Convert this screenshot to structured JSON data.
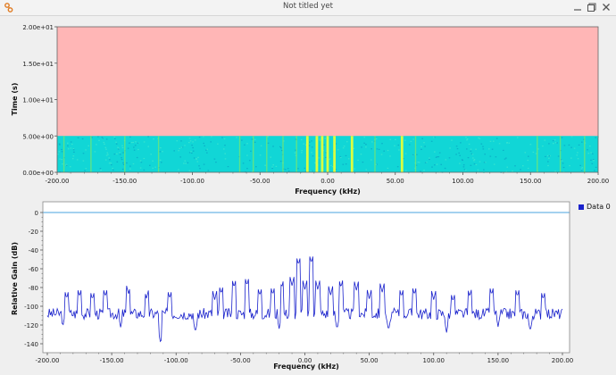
{
  "window": {
    "title": "Not titled yet"
  },
  "colors": {
    "waterfall_background": "#ffb6b6",
    "waterfall_fill": "#11d6d6",
    "waterfall_strong": "#e4ff3a",
    "spectrum_trace": "#1a22cc",
    "reference_line": "#4aa3df"
  },
  "icons": {
    "app": "gnuradio-icon",
    "minimize": "minimize-icon",
    "maximize": "maximize-icon",
    "close": "close-icon"
  },
  "waterfall": {
    "ylabel": "Time (s)",
    "xlabel": "Frequency (kHz)",
    "ytick_labels": [
      "2.00e+01",
      "1.50e+01",
      "1.00e+01",
      "5.00e+00",
      "0.00e+00"
    ],
    "xtick_labels": [
      "-200.00",
      "-150.00",
      "-100.00",
      "-50.00",
      "0.00",
      "50.00",
      "100.00",
      "150.00",
      "200.00"
    ]
  },
  "spectrum": {
    "ylabel": "Relative Gain (dB)",
    "xlabel": "Frequency (kHz)",
    "legend": "Data 0",
    "ytick_labels": [
      "0",
      "-20",
      "-40",
      "-60",
      "-80",
      "-100",
      "-120",
      "-140"
    ],
    "xtick_labels": [
      "-200.00",
      "-150.00",
      "-100.00",
      "-50.00",
      "0.00",
      "50.00",
      "100.00",
      "150.00",
      "200.00"
    ]
  },
  "chart_data": [
    {
      "type": "heatmap",
      "xlabel": "Frequency (kHz)",
      "ylabel": "Time (s)",
      "xlim": [
        -200,
        200
      ],
      "ylim": [
        0,
        20
      ],
      "filled_time_range": [
        0,
        5
      ],
      "bright_line_frequencies": [
        -195,
        -175,
        -150,
        -125,
        -65,
        -55,
        -45,
        -33,
        -23,
        -15,
        -8,
        -4,
        0,
        5,
        18,
        35,
        55,
        65,
        155,
        172,
        190
      ]
    },
    {
      "type": "line",
      "xlabel": "Frequency (kHz)",
      "ylabel": "Relative Gain (dB)",
      "xlim": [
        -200,
        200
      ],
      "ylim": [
        -140,
        0
      ],
      "reference_level": 0,
      "series": [
        {
          "name": "Data 0",
          "noise_floor": -108,
          "peaks": [
            {
              "x": -185,
              "y": -92
            },
            {
              "x": -175,
              "y": -90
            },
            {
              "x": -165,
              "y": -93
            },
            {
              "x": -155,
              "y": -90
            },
            {
              "x": -137,
              "y": -87
            },
            {
              "x": -123,
              "y": -92
            },
            {
              "x": -105,
              "y": -92
            },
            {
              "x": -85,
              "y": -96
            },
            {
              "x": -70,
              "y": -93
            },
            {
              "x": -65,
              "y": -87
            },
            {
              "x": -55,
              "y": -80
            },
            {
              "x": -45,
              "y": -78
            },
            {
              "x": -35,
              "y": -89
            },
            {
              "x": -25,
              "y": -88
            },
            {
              "x": -18,
              "y": -80
            },
            {
              "x": -10,
              "y": -78
            },
            {
              "x": -5,
              "y": -56
            },
            {
              "x": 0,
              "y": -82
            },
            {
              "x": 5,
              "y": -54
            },
            {
              "x": 10,
              "y": -82
            },
            {
              "x": 20,
              "y": -88
            },
            {
              "x": 28,
              "y": -80
            },
            {
              "x": 40,
              "y": -83
            },
            {
              "x": 50,
              "y": -92
            },
            {
              "x": 60,
              "y": -85
            },
            {
              "x": 75,
              "y": -90
            },
            {
              "x": 85,
              "y": -88
            },
            {
              "x": 100,
              "y": -93
            },
            {
              "x": 115,
              "y": -95
            },
            {
              "x": 128,
              "y": -90
            },
            {
              "x": 145,
              "y": -88
            },
            {
              "x": 165,
              "y": -90
            },
            {
              "x": 185,
              "y": -93
            }
          ],
          "dips": [
            {
              "x": -188,
              "y": -122
            },
            {
              "x": -143,
              "y": -123
            },
            {
              "x": -112,
              "y": -140
            },
            {
              "x": -85,
              "y": -128
            },
            {
              "x": -20,
              "y": -124
            },
            {
              "x": 25,
              "y": -125
            },
            {
              "x": 65,
              "y": -126
            },
            {
              "x": 110,
              "y": -128
            },
            {
              "x": 150,
              "y": -122
            },
            {
              "x": 175,
              "y": -127
            }
          ]
        }
      ]
    }
  ]
}
